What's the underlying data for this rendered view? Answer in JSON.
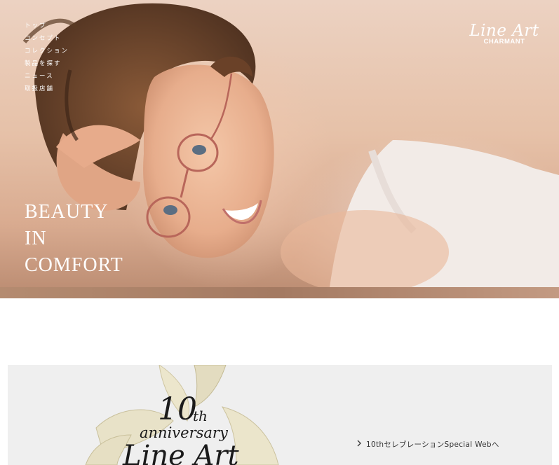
{
  "nav": {
    "items": [
      "トップ",
      "コンセプト",
      "コレクション",
      "製品を探す",
      "ニュース",
      "取扱店舗"
    ]
  },
  "logo": {
    "script": "Line Art",
    "brand": "CHARMANT"
  },
  "hero": {
    "tagline": [
      "BEAUTY",
      "IN",
      "COMFORT"
    ]
  },
  "banner": {
    "art_text": {
      "number": "10",
      "suffix": "th",
      "word": "anniversary",
      "brand": "Line Art"
    },
    "link_label": "10thセレブレーションSpecial Webへ",
    "link_icon": "chevron-right-icon"
  },
  "colors": {
    "banner_bg": "#efefef",
    "text_white": "#ffffff",
    "frame_rose": "#b8665a"
  }
}
